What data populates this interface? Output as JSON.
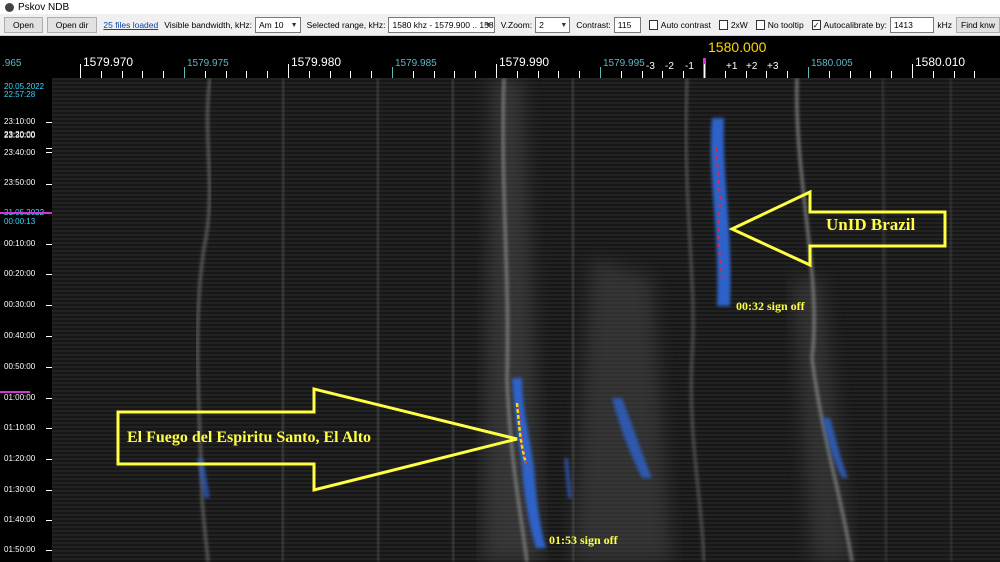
{
  "window": {
    "title": "Pskov NDB"
  },
  "toolbar": {
    "open_label": "Open",
    "open_dir_label": "Open dir",
    "files_loaded_link": "25 files loaded",
    "visible_bw_label": "Visible bandwidth, kHz:",
    "visible_bw_value": "Am 10",
    "selected_range_label": "Selected range, kHz:",
    "selected_range_value": "1580 khz - 1579.900 .. 1580.",
    "vzoom_label": "V.Zoom:",
    "vzoom_value": "2",
    "contrast_label": "Contrast:",
    "contrast_value": "115",
    "auto_contrast_label": "Auto contrast",
    "auto_contrast_checked": false,
    "twoxw_label": "2xW",
    "twoxw_checked": false,
    "no_tooltip_label": "No tooltip",
    "no_tooltip_checked": false,
    "autocalibrate_label": "Autocalibrate by:",
    "autocalibrate_checked": true,
    "autocalibrate_value": "1413",
    "khz_unit": "kHz",
    "find_label": "Find knw"
  },
  "ruler": {
    "edge_label": ".965",
    "major": [
      "1579.970",
      "1579.980",
      "1579.990",
      "1580.010"
    ],
    "minor": [
      "1579.975",
      "1579.985",
      "1579.995",
      "1580.005"
    ],
    "center_label": "1580.000",
    "offsets_minus": [
      "-3",
      "-2",
      "-1"
    ],
    "offsets_plus": [
      "+1",
      "+2",
      "+3"
    ]
  },
  "time_axis": {
    "start_date": "20.05.2022",
    "start_time": "22:57:28",
    "labels": [
      "23:10:00",
      "23:20:00",
      "23:30:00",
      "23:40:00",
      "23:50:00",
      "00:10:00",
      "00:20:00",
      "00:30:00",
      "00:40:00",
      "00:50:00",
      "01:00:00",
      "01:10:00",
      "01:20:00",
      "01:30:00",
      "01:40:00",
      "01:50:00"
    ],
    "date_change": "21.05.2022",
    "date_change_time": "00:00:13"
  },
  "annotations": {
    "brazil_arrow": "UnID Brazil",
    "brazil_signoff": "00:32 sign off",
    "elalto_arrow": "El Fuego del Espiritu Santo, El Alto",
    "elalto_signoff": "01:53 sign off"
  },
  "colors": {
    "annotation_yellow": "#ffff44",
    "center_magenta": "#d633d6",
    "minor_tick_cyan": "#5fb6c6",
    "time_cyan": "#33d8ff"
  }
}
